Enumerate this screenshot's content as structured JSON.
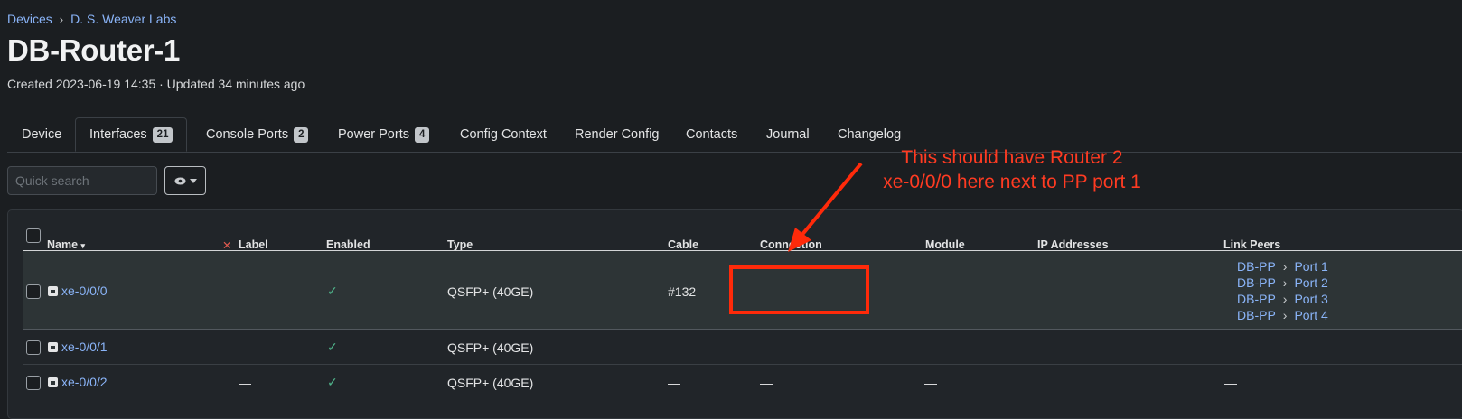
{
  "breadcrumb": {
    "items": [
      "Devices",
      "D. S. Weaver Labs"
    ]
  },
  "device": {
    "title": "DB-Router-1",
    "meta": "Created 2023-06-19 14:35 · Updated 34 minutes ago"
  },
  "tabs": [
    {
      "label": "Device"
    },
    {
      "label": "Interfaces",
      "badge": "21",
      "active": true
    },
    {
      "label": "Console Ports",
      "badge": "2"
    },
    {
      "label": "Power Ports",
      "badge": "4"
    },
    {
      "label": "Config Context"
    },
    {
      "label": "Render Config"
    },
    {
      "label": "Contacts"
    },
    {
      "label": "Journal"
    },
    {
      "label": "Changelog"
    }
  ],
  "toolbar": {
    "search_placeholder": "Quick search"
  },
  "table": {
    "columns": [
      "Name",
      "Label",
      "Enabled",
      "Type",
      "Cable",
      "Connection",
      "Module",
      "IP Addresses",
      "Link Peers"
    ],
    "rows": [
      {
        "name": "xe-0/0/0",
        "label": "—",
        "enabled": "✓",
        "type": "QSFP+ (40GE)",
        "cable": "#132",
        "connection": "—",
        "module": "—",
        "ip": "",
        "peers": [
          [
            "DB-PP",
            "Port 1"
          ],
          [
            "DB-PP",
            "Port 2"
          ],
          [
            "DB-PP",
            "Port 3"
          ],
          [
            "DB-PP",
            "Port 4"
          ]
        ]
      },
      {
        "name": "xe-0/0/1",
        "label": "—",
        "enabled": "✓",
        "type": "QSFP+ (40GE)",
        "cable": "—",
        "connection": "—",
        "module": "—",
        "ip": "",
        "peers_text": "—"
      },
      {
        "name": "xe-0/0/2",
        "label": "—",
        "enabled": "✓",
        "type": "QSFP+ (40GE)",
        "cable": "—",
        "connection": "—",
        "module": "—",
        "ip": "",
        "peers_text": "—"
      }
    ]
  },
  "annotation": {
    "line1": "This should have Router 2",
    "line2": "xe-0/0/0 here next to PP port 1",
    "color": "#ff3b22"
  },
  "colors": {
    "link": "#8ab4f8",
    "check": "#4fb38a",
    "annotation_red": "#ff2a0a"
  }
}
